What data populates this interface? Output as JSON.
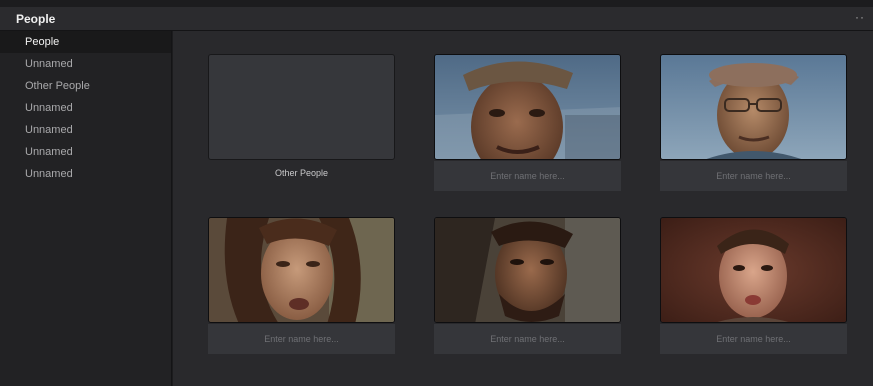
{
  "window": {
    "title": "People",
    "more_icon": "more-dots-icon"
  },
  "sidebar": {
    "items": [
      {
        "label": "People",
        "active": true
      },
      {
        "label": "Unnamed"
      },
      {
        "label": "Other People"
      },
      {
        "label": "Unnamed"
      },
      {
        "label": "Unnamed"
      },
      {
        "label": "Unnamed"
      },
      {
        "label": "Unnamed"
      }
    ]
  },
  "grid": {
    "cards": [
      {
        "caption": "Other People"
      },
      {
        "placeholder": "Enter name here..."
      },
      {
        "placeholder": "Enter name here..."
      },
      {
        "placeholder": "Enter name here..."
      },
      {
        "placeholder": "Enter name here..."
      },
      {
        "placeholder": "Enter name here..."
      }
    ]
  }
}
